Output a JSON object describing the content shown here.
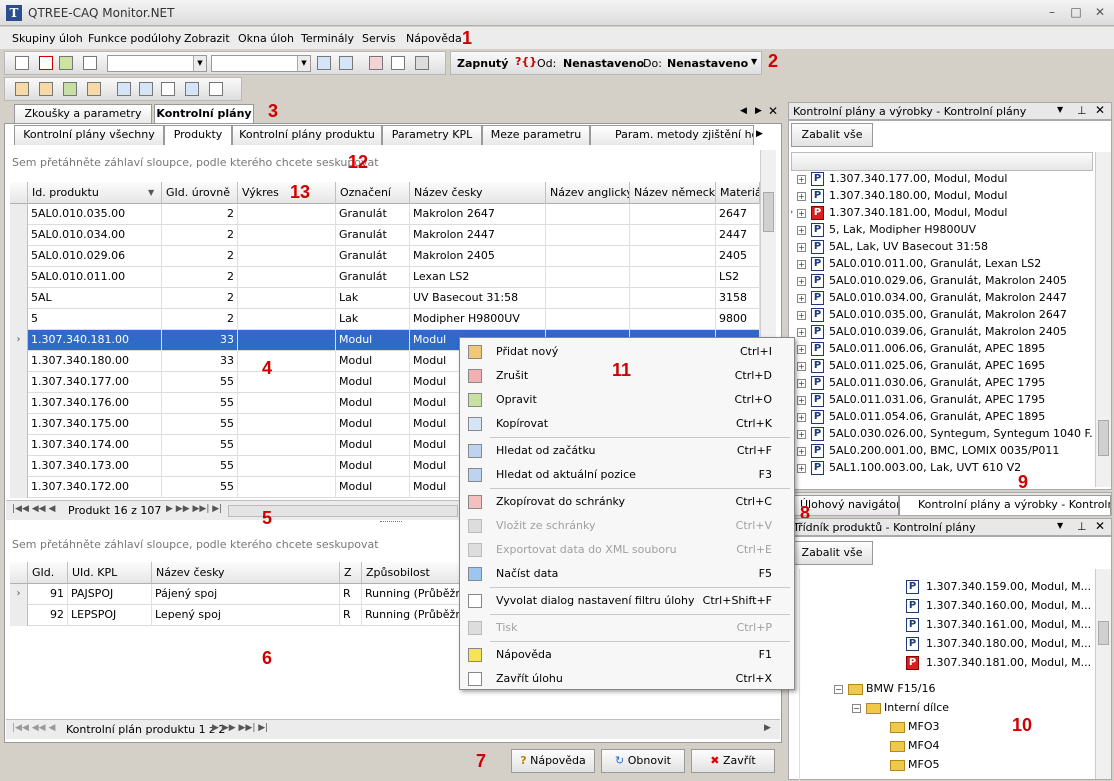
{
  "window": {
    "title": "QTREE-CAQ Monitor.NET",
    "app_letter": "T"
  },
  "menu": [
    "Skupiny úloh",
    "Funkce podúlohy",
    "Zobrazit",
    "Okna úloh",
    "Terminály",
    "Servis",
    "Nápověda"
  ],
  "filterbar": {
    "state": "Zapnutý",
    "from_label": "Od:",
    "from_value": "Nenastaveno",
    "to_label": "Do:",
    "to_value": "Nenastaveno"
  },
  "annotations": [
    "1",
    "2",
    "3",
    "4",
    "5",
    "6",
    "7",
    "8",
    "9",
    "10",
    "11",
    "12",
    "13"
  ],
  "main_tabs": [
    "Zkoušky a parametry",
    "Kontrolní plány"
  ],
  "sub_tabs": [
    "Kontrolní plány všechny",
    "Produkty",
    "Kontrolní plány produktu",
    "Parametry KPL",
    "Meze parametru",
    "Param. metody zjištění hodr"
  ],
  "group_hint": "Sem přetáhněte záhlaví sloupce, podle kterého chcete seskupovat",
  "products": {
    "columns": [
      "Id. produktu",
      "GId. úrovně",
      "Výkres",
      "Označení",
      "Název česky",
      "Název anglicky",
      "Název německy",
      "Materiá"
    ],
    "rows": [
      [
        "5AL0.010.035.00",
        "2",
        "",
        "Granulát",
        "Makrolon 2647",
        "",
        "",
        "2647"
      ],
      [
        "5AL0.010.034.00",
        "2",
        "",
        "Granulát",
        "Makrolon 2447",
        "",
        "",
        "2447"
      ],
      [
        "5AL0.010.029.06",
        "2",
        "",
        "Granulát",
        "Makrolon 2405",
        "",
        "",
        "2405"
      ],
      [
        "5AL0.010.011.00",
        "2",
        "",
        "Granulát",
        "Lexan LS2",
        "",
        "",
        "LS2"
      ],
      [
        "5AL",
        "2",
        "",
        "Lak",
        "UV Basecout 31:58",
        "",
        "",
        "3158"
      ],
      [
        "5",
        "2",
        "",
        "Lak",
        "Modipher H9800UV",
        "",
        "",
        "9800"
      ],
      [
        "1.307.340.181.00",
        "33",
        "",
        "Modul",
        "Modul",
        "",
        "",
        ""
      ],
      [
        "1.307.340.180.00",
        "33",
        "",
        "Modul",
        "Modul",
        "",
        "",
        ""
      ],
      [
        "1.307.340.177.00",
        "55",
        "",
        "Modul",
        "Modul",
        "",
        "",
        ""
      ],
      [
        "1.307.340.176.00",
        "55",
        "",
        "Modul",
        "Modul",
        "",
        "",
        ""
      ],
      [
        "1.307.340.175.00",
        "55",
        "",
        "Modul",
        "Modul",
        "",
        "",
        ""
      ],
      [
        "1.307.340.174.00",
        "55",
        "",
        "Modul",
        "Modul",
        "",
        "",
        ""
      ],
      [
        "1.307.340.173.00",
        "55",
        "",
        "Modul",
        "Modul",
        "",
        "",
        ""
      ],
      [
        "1.307.340.172.00",
        "55",
        "",
        "Modul",
        "Modul",
        "",
        "",
        ""
      ]
    ],
    "nav_text": "Produkt 16 z 107"
  },
  "plans": {
    "columns": [
      "GId.",
      "UId. KPL",
      "Název česky",
      "Z",
      "Způsobilost"
    ],
    "rows": [
      [
        "91",
        "PAJSPOJ",
        "Pájený spoj",
        "R",
        "Running (Průběžná"
      ],
      [
        "92",
        "LEPSPOJ",
        "Lepený spoj",
        "R",
        "Running (Průběžná"
      ]
    ],
    "nav_text": "Kontrolní plán produktu 1 z 2"
  },
  "buttons": {
    "help": "Nápověda",
    "refresh": "Obnovit",
    "close": "Zavřít"
  },
  "context_menu": [
    {
      "label": "Přidat nový",
      "shortcut": "Ctrl+I",
      "disabled": false
    },
    {
      "label": "Zrušit",
      "shortcut": "Ctrl+D",
      "disabled": false
    },
    {
      "label": "Opravit",
      "shortcut": "Ctrl+O",
      "disabled": false
    },
    {
      "label": "Kopírovat",
      "shortcut": "Ctrl+K",
      "disabled": false
    },
    {
      "label": "Hledat od začátku",
      "shortcut": "Ctrl+F",
      "disabled": false
    },
    {
      "label": "Hledat od aktuální pozice",
      "shortcut": "F3",
      "disabled": false
    },
    {
      "label": "Zkopírovat do schránky",
      "shortcut": "Ctrl+C",
      "disabled": false
    },
    {
      "label": "Vložit ze schránky",
      "shortcut": "Ctrl+V",
      "disabled": true
    },
    {
      "label": "Exportovat data do XML souboru",
      "shortcut": "Ctrl+E",
      "disabled": true
    },
    {
      "label": "Načíst data",
      "shortcut": "F5",
      "disabled": false
    },
    {
      "label": "Vyvolat dialog nastavení filtru úlohy",
      "shortcut": "Ctrl+Shift+F",
      "disabled": false
    },
    {
      "label": "Tisk",
      "shortcut": "Ctrl+P",
      "disabled": true
    },
    {
      "label": "Nápověda",
      "shortcut": "F1",
      "disabled": false
    },
    {
      "label": "Zavřít úlohu",
      "shortcut": "Ctrl+X",
      "disabled": false
    }
  ],
  "right_top": {
    "title": "Kontrolní plány a výrobky - Kontrolní plány",
    "collapse": "Zabalit vše",
    "items": [
      {
        "text": "1.307.340.177.00, Modul, Modul",
        "red": false
      },
      {
        "text": "1.307.340.180.00, Modul, Modul",
        "red": false
      },
      {
        "text": "1.307.340.181.00, Modul, Modul",
        "red": true
      },
      {
        "text": "5, Lak, Modipher H9800UV",
        "red": false
      },
      {
        "text": "5AL, Lak, UV Basecout 31:58",
        "red": false
      },
      {
        "text": "5AL0.010.011.00, Granulát, Lexan LS2",
        "red": false
      },
      {
        "text": "5AL0.010.029.06, Granulát, Makrolon 2405",
        "red": false
      },
      {
        "text": "5AL0.010.034.00, Granulát, Makrolon 2447",
        "red": false
      },
      {
        "text": "5AL0.010.035.00, Granulát, Makrolon 2647",
        "red": false
      },
      {
        "text": "5AL0.010.039.06, Granulát, Makrolon 2405",
        "red": false
      },
      {
        "text": "5AL0.011.006.06, Granulát, APEC 1895",
        "red": false
      },
      {
        "text": "5AL0.011.025.06, Granulát, APEC 1695",
        "red": false
      },
      {
        "text": "5AL0.011.030.06, Granulát, APEC 1795",
        "red": false
      },
      {
        "text": "5AL0.011.031.06, Granulát, APEC 1795",
        "red": false
      },
      {
        "text": "5AL0.011.054.06, Granulát, APEC 1895",
        "red": false
      },
      {
        "text": "5AL0.030.026.00, Syntegum, Syntegum 1040 F...",
        "red": false
      },
      {
        "text": "5AL0.200.001.00, BMC, LOMIX 0035/P011",
        "red": false
      },
      {
        "text": "5AL1.100.003.00, Lak, UVT 610 V2",
        "red": false
      }
    ],
    "tabs": [
      "Úlohový navigátor",
      "Kontrolní plány a výrobky - Kontrolní p..."
    ]
  },
  "right_bottom": {
    "title": "Třídník produktů - Kontrolní plány",
    "collapse": "Zabalit vše",
    "items": [
      {
        "text": "1.307.340.159.00, Modul, M...",
        "red": false
      },
      {
        "text": "1.307.340.160.00, Modul, M...",
        "red": false
      },
      {
        "text": "1.307.340.161.00, Modul, M...",
        "red": false
      },
      {
        "text": "1.307.340.180.00, Modul, M...",
        "red": false
      },
      {
        "text": "1.307.340.181.00, Modul, M...",
        "red": true
      }
    ],
    "folders": [
      "BMW F15/16",
      "Interní dílce",
      "MFO3",
      "MFO4",
      "MFO5"
    ]
  }
}
